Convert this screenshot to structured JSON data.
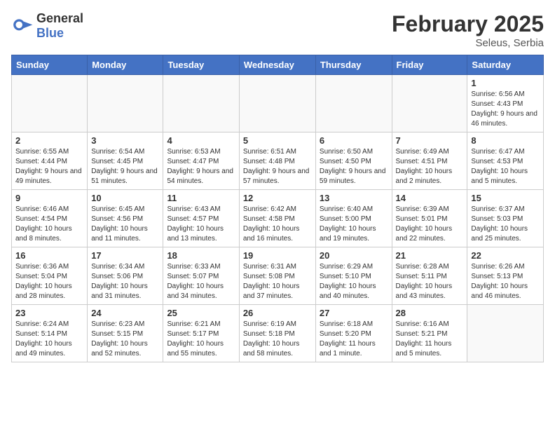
{
  "header": {
    "logo_general": "General",
    "logo_blue": "Blue",
    "title": "February 2025",
    "subtitle": "Seleus, Serbia"
  },
  "days_of_week": [
    "Sunday",
    "Monday",
    "Tuesday",
    "Wednesday",
    "Thursday",
    "Friday",
    "Saturday"
  ],
  "weeks": [
    [
      {
        "day": "",
        "info": ""
      },
      {
        "day": "",
        "info": ""
      },
      {
        "day": "",
        "info": ""
      },
      {
        "day": "",
        "info": ""
      },
      {
        "day": "",
        "info": ""
      },
      {
        "day": "",
        "info": ""
      },
      {
        "day": "1",
        "info": "Sunrise: 6:56 AM\nSunset: 4:43 PM\nDaylight: 9 hours and 46 minutes."
      }
    ],
    [
      {
        "day": "2",
        "info": "Sunrise: 6:55 AM\nSunset: 4:44 PM\nDaylight: 9 hours and 49 minutes."
      },
      {
        "day": "3",
        "info": "Sunrise: 6:54 AM\nSunset: 4:45 PM\nDaylight: 9 hours and 51 minutes."
      },
      {
        "day": "4",
        "info": "Sunrise: 6:53 AM\nSunset: 4:47 PM\nDaylight: 9 hours and 54 minutes."
      },
      {
        "day": "5",
        "info": "Sunrise: 6:51 AM\nSunset: 4:48 PM\nDaylight: 9 hours and 57 minutes."
      },
      {
        "day": "6",
        "info": "Sunrise: 6:50 AM\nSunset: 4:50 PM\nDaylight: 9 hours and 59 minutes."
      },
      {
        "day": "7",
        "info": "Sunrise: 6:49 AM\nSunset: 4:51 PM\nDaylight: 10 hours and 2 minutes."
      },
      {
        "day": "8",
        "info": "Sunrise: 6:47 AM\nSunset: 4:53 PM\nDaylight: 10 hours and 5 minutes."
      }
    ],
    [
      {
        "day": "9",
        "info": "Sunrise: 6:46 AM\nSunset: 4:54 PM\nDaylight: 10 hours and 8 minutes."
      },
      {
        "day": "10",
        "info": "Sunrise: 6:45 AM\nSunset: 4:56 PM\nDaylight: 10 hours and 11 minutes."
      },
      {
        "day": "11",
        "info": "Sunrise: 6:43 AM\nSunset: 4:57 PM\nDaylight: 10 hours and 13 minutes."
      },
      {
        "day": "12",
        "info": "Sunrise: 6:42 AM\nSunset: 4:58 PM\nDaylight: 10 hours and 16 minutes."
      },
      {
        "day": "13",
        "info": "Sunrise: 6:40 AM\nSunset: 5:00 PM\nDaylight: 10 hours and 19 minutes."
      },
      {
        "day": "14",
        "info": "Sunrise: 6:39 AM\nSunset: 5:01 PM\nDaylight: 10 hours and 22 minutes."
      },
      {
        "day": "15",
        "info": "Sunrise: 6:37 AM\nSunset: 5:03 PM\nDaylight: 10 hours and 25 minutes."
      }
    ],
    [
      {
        "day": "16",
        "info": "Sunrise: 6:36 AM\nSunset: 5:04 PM\nDaylight: 10 hours and 28 minutes."
      },
      {
        "day": "17",
        "info": "Sunrise: 6:34 AM\nSunset: 5:06 PM\nDaylight: 10 hours and 31 minutes."
      },
      {
        "day": "18",
        "info": "Sunrise: 6:33 AM\nSunset: 5:07 PM\nDaylight: 10 hours and 34 minutes."
      },
      {
        "day": "19",
        "info": "Sunrise: 6:31 AM\nSunset: 5:08 PM\nDaylight: 10 hours and 37 minutes."
      },
      {
        "day": "20",
        "info": "Sunrise: 6:29 AM\nSunset: 5:10 PM\nDaylight: 10 hours and 40 minutes."
      },
      {
        "day": "21",
        "info": "Sunrise: 6:28 AM\nSunset: 5:11 PM\nDaylight: 10 hours and 43 minutes."
      },
      {
        "day": "22",
        "info": "Sunrise: 6:26 AM\nSunset: 5:13 PM\nDaylight: 10 hours and 46 minutes."
      }
    ],
    [
      {
        "day": "23",
        "info": "Sunrise: 6:24 AM\nSunset: 5:14 PM\nDaylight: 10 hours and 49 minutes."
      },
      {
        "day": "24",
        "info": "Sunrise: 6:23 AM\nSunset: 5:15 PM\nDaylight: 10 hours and 52 minutes."
      },
      {
        "day": "25",
        "info": "Sunrise: 6:21 AM\nSunset: 5:17 PM\nDaylight: 10 hours and 55 minutes."
      },
      {
        "day": "26",
        "info": "Sunrise: 6:19 AM\nSunset: 5:18 PM\nDaylight: 10 hours and 58 minutes."
      },
      {
        "day": "27",
        "info": "Sunrise: 6:18 AM\nSunset: 5:20 PM\nDaylight: 11 hours and 1 minute."
      },
      {
        "day": "28",
        "info": "Sunrise: 6:16 AM\nSunset: 5:21 PM\nDaylight: 11 hours and 5 minutes."
      },
      {
        "day": "",
        "info": ""
      }
    ]
  ]
}
